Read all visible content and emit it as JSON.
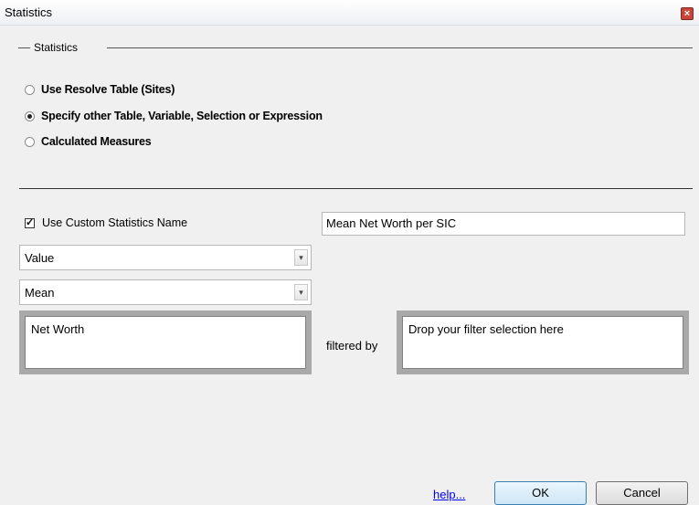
{
  "window": {
    "title": "Statistics",
    "close_glyph": "×"
  },
  "group": {
    "label": "Statistics"
  },
  "radios": [
    {
      "label": "Use Resolve Table (Sites)",
      "checked": false
    },
    {
      "label": "Specify other Table, Variable, Selection or Expression",
      "checked": true
    },
    {
      "label": "Calculated Measures",
      "checked": false
    }
  ],
  "custom_name": {
    "label": "Use Custom Statistics Name",
    "checked": true,
    "check_glyph": "✓",
    "value": "Mean Net Worth per SIC"
  },
  "dropdowns": {
    "type_value": "Value",
    "stat_value": "Mean",
    "arrow_glyph": "▾"
  },
  "drop_areas": {
    "field": "Net Worth",
    "filtered_by_label": "filtered by",
    "filter_placeholder": "Drop your filter selection here"
  },
  "footer": {
    "help_label": "help...",
    "ok_label": "OK",
    "cancel_label": "Cancel"
  }
}
